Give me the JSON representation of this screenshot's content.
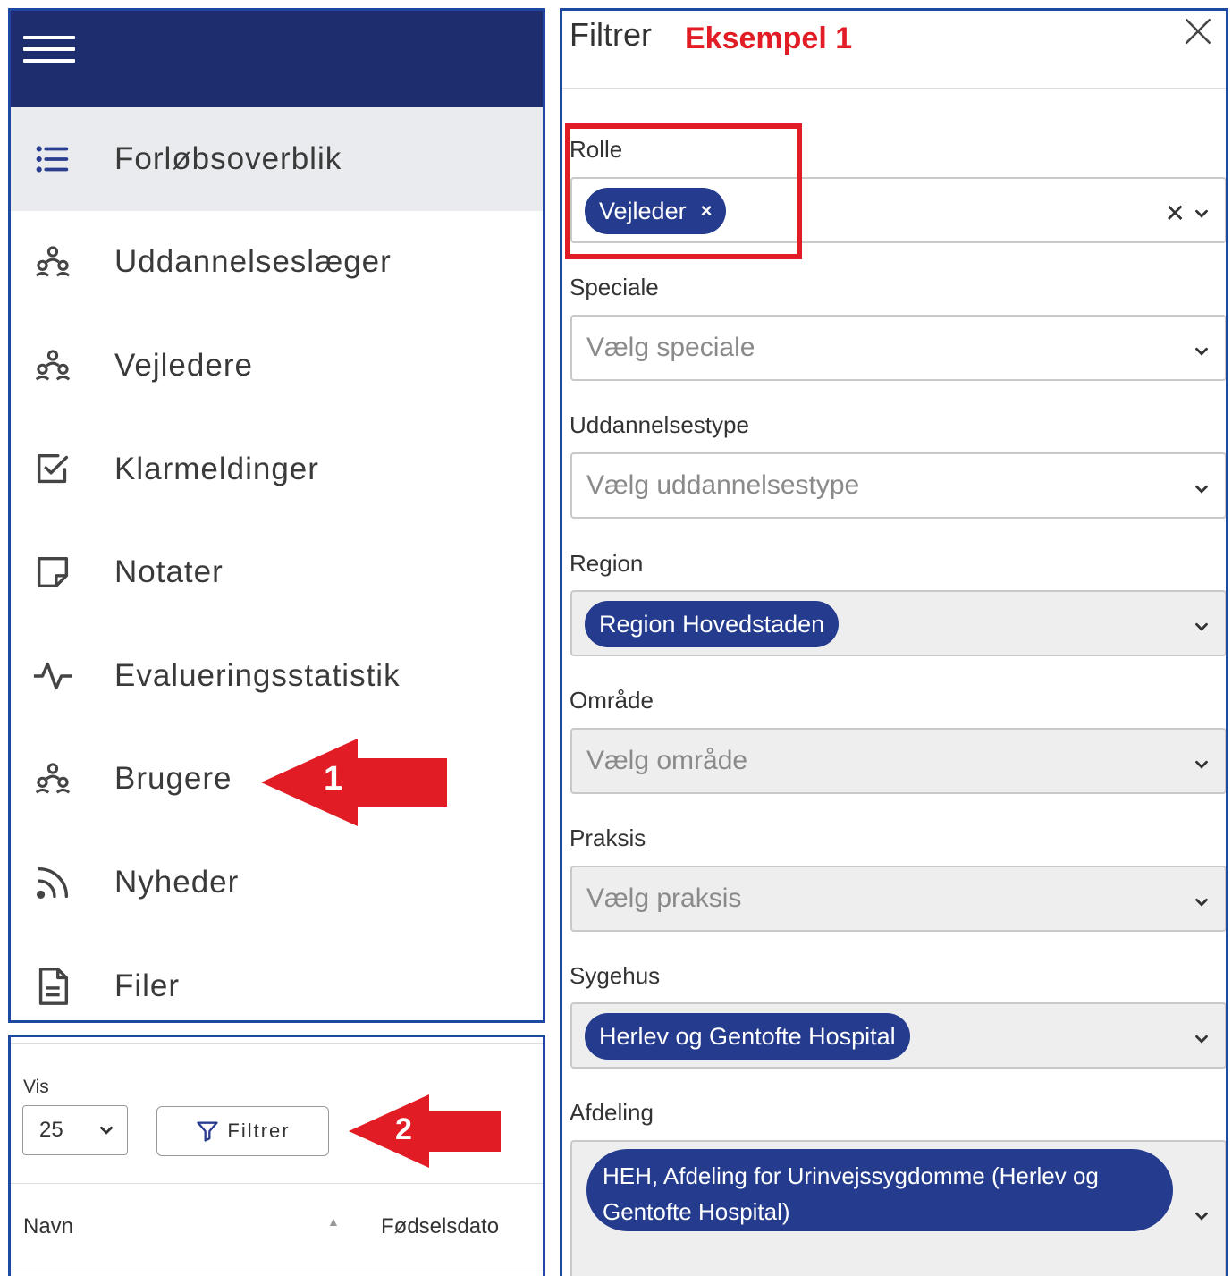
{
  "sidebar": {
    "items": [
      {
        "label": "Forløbsoverblik",
        "icon": "list-icon",
        "active": true
      },
      {
        "label": "Uddannelseslæger",
        "icon": "users-icon"
      },
      {
        "label": "Vejledere",
        "icon": "users-icon"
      },
      {
        "label": "Klarmeldinger",
        "icon": "check-square-icon"
      },
      {
        "label": "Notater",
        "icon": "note-icon"
      },
      {
        "label": "Evalueringsstatistik",
        "icon": "activity-icon"
      },
      {
        "label": "Brugere",
        "icon": "users-icon"
      },
      {
        "label": "Nyheder",
        "icon": "rss-icon"
      },
      {
        "label": "Filer",
        "icon": "file-icon"
      }
    ]
  },
  "annotations": {
    "arrow1": "1",
    "arrow2": "2",
    "example": "Eksempel 1",
    "color": "#e21c24"
  },
  "table_toolbar": {
    "vis_label": "Vis",
    "page_size": "25",
    "filter_button": "Filtrer",
    "columns": [
      "Navn",
      "Fødselsdato"
    ]
  },
  "filter_panel": {
    "title": "Filtrer",
    "fields": {
      "rolle": {
        "label": "Rolle",
        "chip": "Vejleder"
      },
      "speciale": {
        "label": "Speciale",
        "placeholder": "Vælg speciale"
      },
      "uddannelsestype": {
        "label": "Uddannelsestype",
        "placeholder": "Vælg uddannelsestype"
      },
      "region": {
        "label": "Region",
        "chip": "Region Hovedstaden"
      },
      "omrade": {
        "label": "Område",
        "placeholder": "Vælg område"
      },
      "praksis": {
        "label": "Praksis",
        "placeholder": "Vælg praksis"
      },
      "sygehus": {
        "label": "Sygehus",
        "chip": "Herlev og Gentofte Hospital"
      },
      "afdeling": {
        "label": "Afdeling",
        "chip": "HEH, Afdeling for Urinvejssygdomme (Herlev og Gentofte Hospital)"
      }
    }
  },
  "colors": {
    "header_bg": "#1e2d6e",
    "chip_bg": "#243b8e",
    "border_blue": "#1d4aa0",
    "highlight_red": "#e21c24"
  }
}
